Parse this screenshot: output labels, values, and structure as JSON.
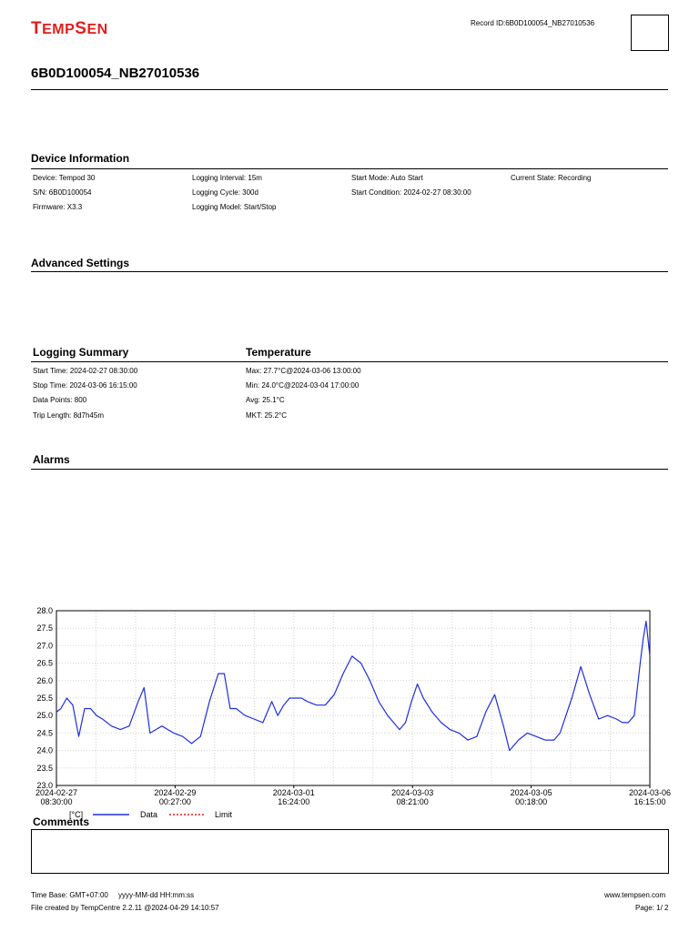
{
  "header": {
    "logo_first": "T",
    "logo_rest": "EMP",
    "logo_second": "S",
    "logo_rest2": "EN",
    "record_id": "Record ID:6B0D100054_NB27010536",
    "title": "6B0D100054_NB27010536"
  },
  "device_info": {
    "heading": "Device Information",
    "col1": [
      "Device: Tempod 30",
      "S/N: 6B0D100054",
      "Firmware: X3.3"
    ],
    "col2": [
      "Logging Interval: 15m",
      "Logging Cycle: 300d",
      "Logging Model: Start/Stop"
    ],
    "col3": [
      "Start Mode: Auto Start",
      "Start Condition: 2024-02-27 08:30:00"
    ],
    "col4": [
      "Current State: Recording"
    ]
  },
  "advanced_settings": {
    "heading": "Advanced Settings"
  },
  "logging_summary": {
    "heading": "Logging Summary",
    "items": [
      "Start Time: 2024-02-27 08:30:00",
      "Stop Time: 2024-03-06 16:15:00",
      "Data Points: 800",
      "Trip Length: 8d7h45m"
    ]
  },
  "temperature": {
    "heading": "Temperature",
    "items": [
      "Max: 27.7°C@2024-03-06 13:00:00",
      "Min: 24.0°C@2024-03-04 17:00:00",
      "Avg: 25.1°C",
      "MKT: 25.2°C"
    ]
  },
  "alarms": {
    "heading": "Alarms"
  },
  "chart_data": {
    "type": "line",
    "ylim": [
      23.0,
      28.0
    ],
    "yticks": [
      "28.0",
      "27.5",
      "27.0",
      "26.5",
      "26.0",
      "25.5",
      "25.0",
      "24.5",
      "24.0",
      "23.5",
      "23.0"
    ],
    "xtick_dates": [
      "2024-02-27",
      "2024-02-29",
      "2024-03-01",
      "2024-03-03",
      "2024-03-05",
      "2024-03-06"
    ],
    "xtick_times": [
      "08:30:00",
      "00:27:00",
      "16:24:00",
      "08:21:00",
      "00:18:00",
      "16:15:00"
    ],
    "unit_label": "[°C]",
    "grid": true,
    "legend_position": "bottom",
    "series": [
      {
        "name": "Data",
        "color": "#1f2fe0",
        "x": [
          "2024-02-27 08:30",
          "2024-02-27 10:00",
          "2024-02-27 12:00",
          "2024-02-27 14:00",
          "2024-02-27 16:00",
          "2024-02-27 18:00",
          "2024-02-27 20:00",
          "2024-02-27 22:00",
          "2024-02-28 00:00",
          "2024-02-28 03:00",
          "2024-02-28 06:00",
          "2024-02-28 09:00",
          "2024-02-28 12:00",
          "2024-02-28 14:00",
          "2024-02-28 16:00",
          "2024-02-28 18:00",
          "2024-02-28 20:00",
          "2024-02-28 22:00",
          "2024-02-29 00:00",
          "2024-02-29 03:00",
          "2024-02-29 06:00",
          "2024-02-29 09:00",
          "2024-02-29 12:00",
          "2024-02-29 15:00",
          "2024-02-29 17:00",
          "2024-02-29 19:00",
          "2024-02-29 21:00",
          "2024-03-01 00:00",
          "2024-03-01 03:00",
          "2024-03-01 06:00",
          "2024-03-01 09:00",
          "2024-03-01 11:00",
          "2024-03-01 13:00",
          "2024-03-01 15:00",
          "2024-03-01 17:00",
          "2024-03-01 19:00",
          "2024-03-01 21:00",
          "2024-03-02 00:00",
          "2024-03-02 03:00",
          "2024-03-02 06:00",
          "2024-03-02 09:00",
          "2024-03-02 12:00",
          "2024-03-02 15:00",
          "2024-03-02 18:00",
          "2024-03-02 21:00",
          "2024-03-03 00:00",
          "2024-03-03 02:00",
          "2024-03-03 04:00",
          "2024-03-03 06:00",
          "2024-03-03 08:00",
          "2024-03-03 10:00",
          "2024-03-03 12:00",
          "2024-03-03 15:00",
          "2024-03-03 18:00",
          "2024-03-03 21:00",
          "2024-03-04 00:00",
          "2024-03-04 03:00",
          "2024-03-04 06:00",
          "2024-03-04 09:00",
          "2024-03-04 12:00",
          "2024-03-04 15:00",
          "2024-03-04 17:00",
          "2024-03-04 20:00",
          "2024-03-04 23:00",
          "2024-03-05 02:00",
          "2024-03-05 05:00",
          "2024-03-05 08:00",
          "2024-03-05 10:00",
          "2024-03-05 12:00",
          "2024-03-05 14:00",
          "2024-03-05 17:00",
          "2024-03-05 20:00",
          "2024-03-05 23:00",
          "2024-03-06 02:00",
          "2024-03-06 05:00",
          "2024-03-06 07:00",
          "2024-03-06 09:00",
          "2024-03-06 11:00",
          "2024-03-06 13:00",
          "2024-03-06 14:00",
          "2024-03-06 15:00",
          "2024-03-06 16:15"
        ],
        "values": [
          25.1,
          25.2,
          25.5,
          25.3,
          24.4,
          25.2,
          25.2,
          25.0,
          24.9,
          24.7,
          24.6,
          24.7,
          25.4,
          25.8,
          24.5,
          24.6,
          24.7,
          24.6,
          24.5,
          24.4,
          24.2,
          24.4,
          25.4,
          26.2,
          26.2,
          25.2,
          25.2,
          25.0,
          24.9,
          24.8,
          25.4,
          25.0,
          25.3,
          25.5,
          25.5,
          25.5,
          25.4,
          25.3,
          25.3,
          25.6,
          26.2,
          26.7,
          26.5,
          26.0,
          25.4,
          25.0,
          24.8,
          24.6,
          24.8,
          25.4,
          25.9,
          25.5,
          25.1,
          24.8,
          24.6,
          24.5,
          24.3,
          24.4,
          25.1,
          25.6,
          24.7,
          24.0,
          24.3,
          24.5,
          24.4,
          24.3,
          24.3,
          24.5,
          25.0,
          25.5,
          26.4,
          25.6,
          24.9,
          25.0,
          24.9,
          24.8,
          24.8,
          25.0,
          26.5,
          27.2,
          27.7,
          26.7
        ]
      },
      {
        "name": "Limit",
        "color": "#e11d1d",
        "values": []
      }
    ]
  },
  "comments": {
    "heading": "Comments"
  },
  "footer": {
    "time_base": "Time Base: GMT+07:00",
    "time_format": "yyyy-MM-dd HH:mm:ss",
    "created": "File created by TempCentre 2.2.11 @2024-04-29 14:10:57",
    "website": "www.tempsen.com",
    "page": "Page: 1/ 2"
  }
}
